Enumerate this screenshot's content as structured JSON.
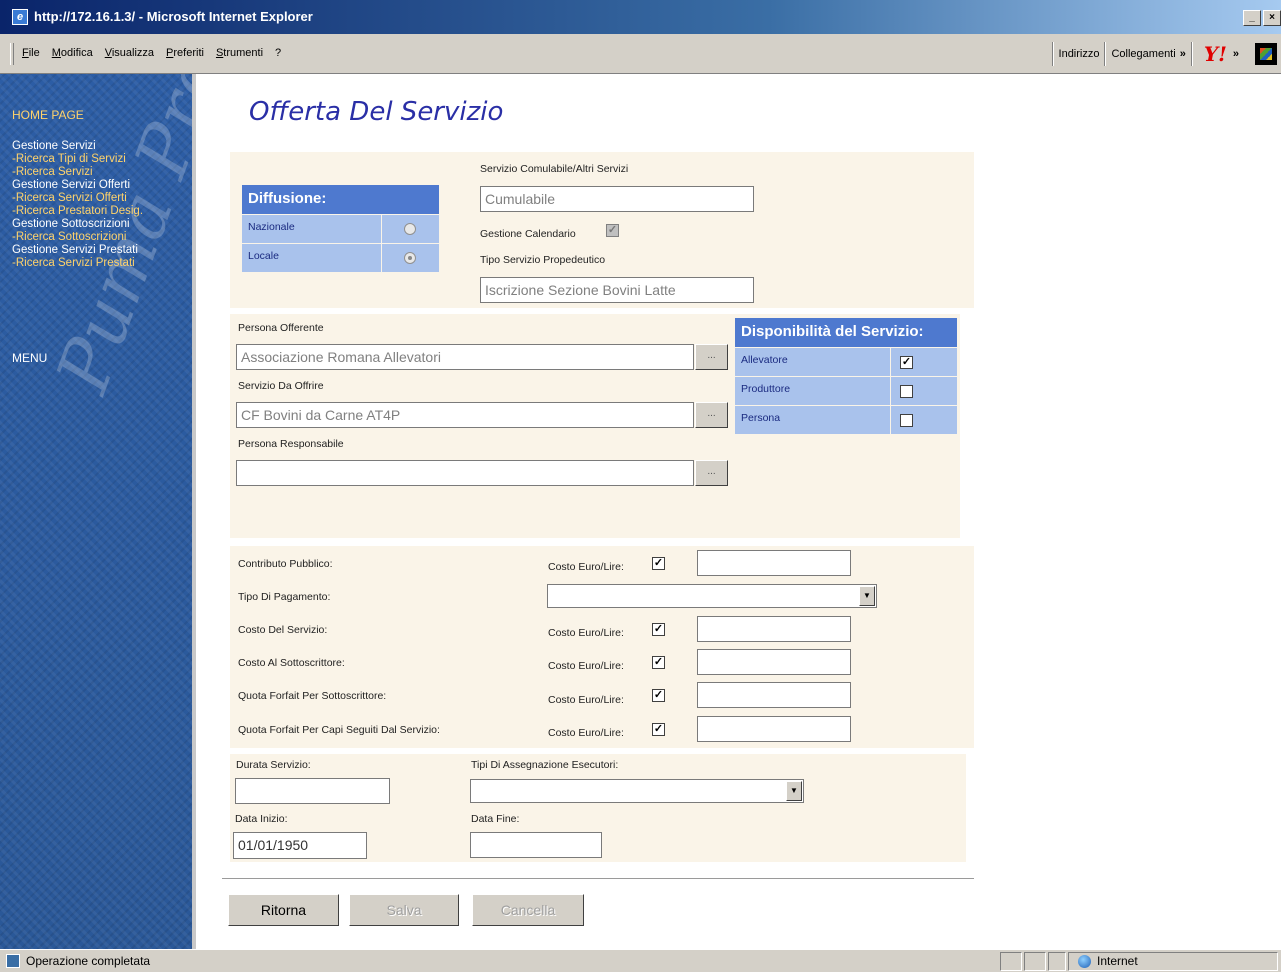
{
  "window": {
    "title": "http://172.16.1.3/ - Microsoft Internet Explorer",
    "buttons": [
      "_",
      "×"
    ]
  },
  "menubar": {
    "items": [
      "File",
      "Modifica",
      "Visualizza",
      "Preferiti",
      "Strumenti",
      "?"
    ],
    "address_label": "Indirizzo",
    "links_label": "Collegamenti",
    "chevron": "»",
    "yahoo": "Y!"
  },
  "sidebar": {
    "home": "HOME PAGE",
    "nav": [
      {
        "text": "Gestione Servizi",
        "type": "group"
      },
      {
        "text": "-Ricerca Tipi di Servizi",
        "type": "link"
      },
      {
        "text": "-Ricerca Servizi",
        "type": "link"
      },
      {
        "text": "Gestione Servizi Offerti",
        "type": "group"
      },
      {
        "text": "-Ricerca Servizi Offerti",
        "type": "link"
      },
      {
        "text": "-Ricerca Prestatori Desig.",
        "type": "link"
      },
      {
        "text": "Gestione Sottoscrizioni",
        "type": "group"
      },
      {
        "text": "-Ricerca Sottoscrizioni",
        "type": "link"
      },
      {
        "text": "Gestione Servizi Prestati",
        "type": "group"
      },
      {
        "text": "-Ricerca Servizi Prestati",
        "type": "link"
      }
    ],
    "menu": "MENU",
    "watermark": "Puma Pro"
  },
  "page": {
    "title": "Offerta Del Servizio"
  },
  "diffusione": {
    "header": "Diffusione:",
    "options": [
      {
        "label": "Nazionale",
        "selected": false
      },
      {
        "label": "Locale",
        "selected": true
      }
    ]
  },
  "servizio": {
    "cumulabile_label": "Servizio Comulabile/Altri Servizi",
    "cumulabile_value": "Cumulabile",
    "calendario_label": "Gestione Calendario",
    "calendario_checked": true,
    "propedeutico_label": "Tipo Servizio Propedeutico",
    "propedeutico_value": "Iscrizione Sezione Bovini Latte"
  },
  "persona": {
    "offerente_label": "Persona Offerente",
    "offerente_value": "Associazione Romana Allevatori",
    "servizio_label": "Servizio Da Offrire",
    "servizio_value": "CF Bovini da Carne AT4P",
    "responsabile_label": "Persona Responsabile",
    "responsabile_value": "",
    "lookup": "..."
  },
  "disponibilita": {
    "header": "Disponibilità del Servizio:",
    "options": [
      {
        "label": "Allevatore",
        "checked": true
      },
      {
        "label": "Produttore",
        "checked": false
      },
      {
        "label": "Persona",
        "checked": false
      }
    ]
  },
  "costi": {
    "costo_label": "Costo Euro/Lire:",
    "rows": [
      {
        "label": "Contributo Pubblico:",
        "checked": true,
        "value": ""
      },
      {
        "label": "Costo Del Servizio:",
        "checked": true,
        "value": ""
      },
      {
        "label": "Costo Al Sottoscrittore:",
        "checked": true,
        "value": ""
      },
      {
        "label": "Quota Forfait Per Sottoscrittore:",
        "checked": true,
        "value": ""
      },
      {
        "label": "Quota Forfait Per Capi Seguiti Dal Servizio:",
        "checked": true,
        "value": ""
      }
    ],
    "pagamento_label": "Tipo Di Pagamento:",
    "pagamento_value": ""
  },
  "durata": {
    "durata_label": "Durata Servizio:",
    "durata_value": "",
    "assegnazione_label": "Tipi Di Assegnazione Esecutori:",
    "assegnazione_value": "",
    "inizio_label": "Data Inizio:",
    "inizio_value": "01/01/1950",
    "fine_label": "Data Fine:",
    "fine_value": ""
  },
  "buttons": {
    "ritorna": "Ritorna",
    "salva": "Salva",
    "cancella": "Cancella"
  },
  "statusbar": {
    "message": "Operazione completata",
    "zone": "Internet"
  },
  "icons": {
    "check": "✓",
    "dropdown": "▼"
  }
}
